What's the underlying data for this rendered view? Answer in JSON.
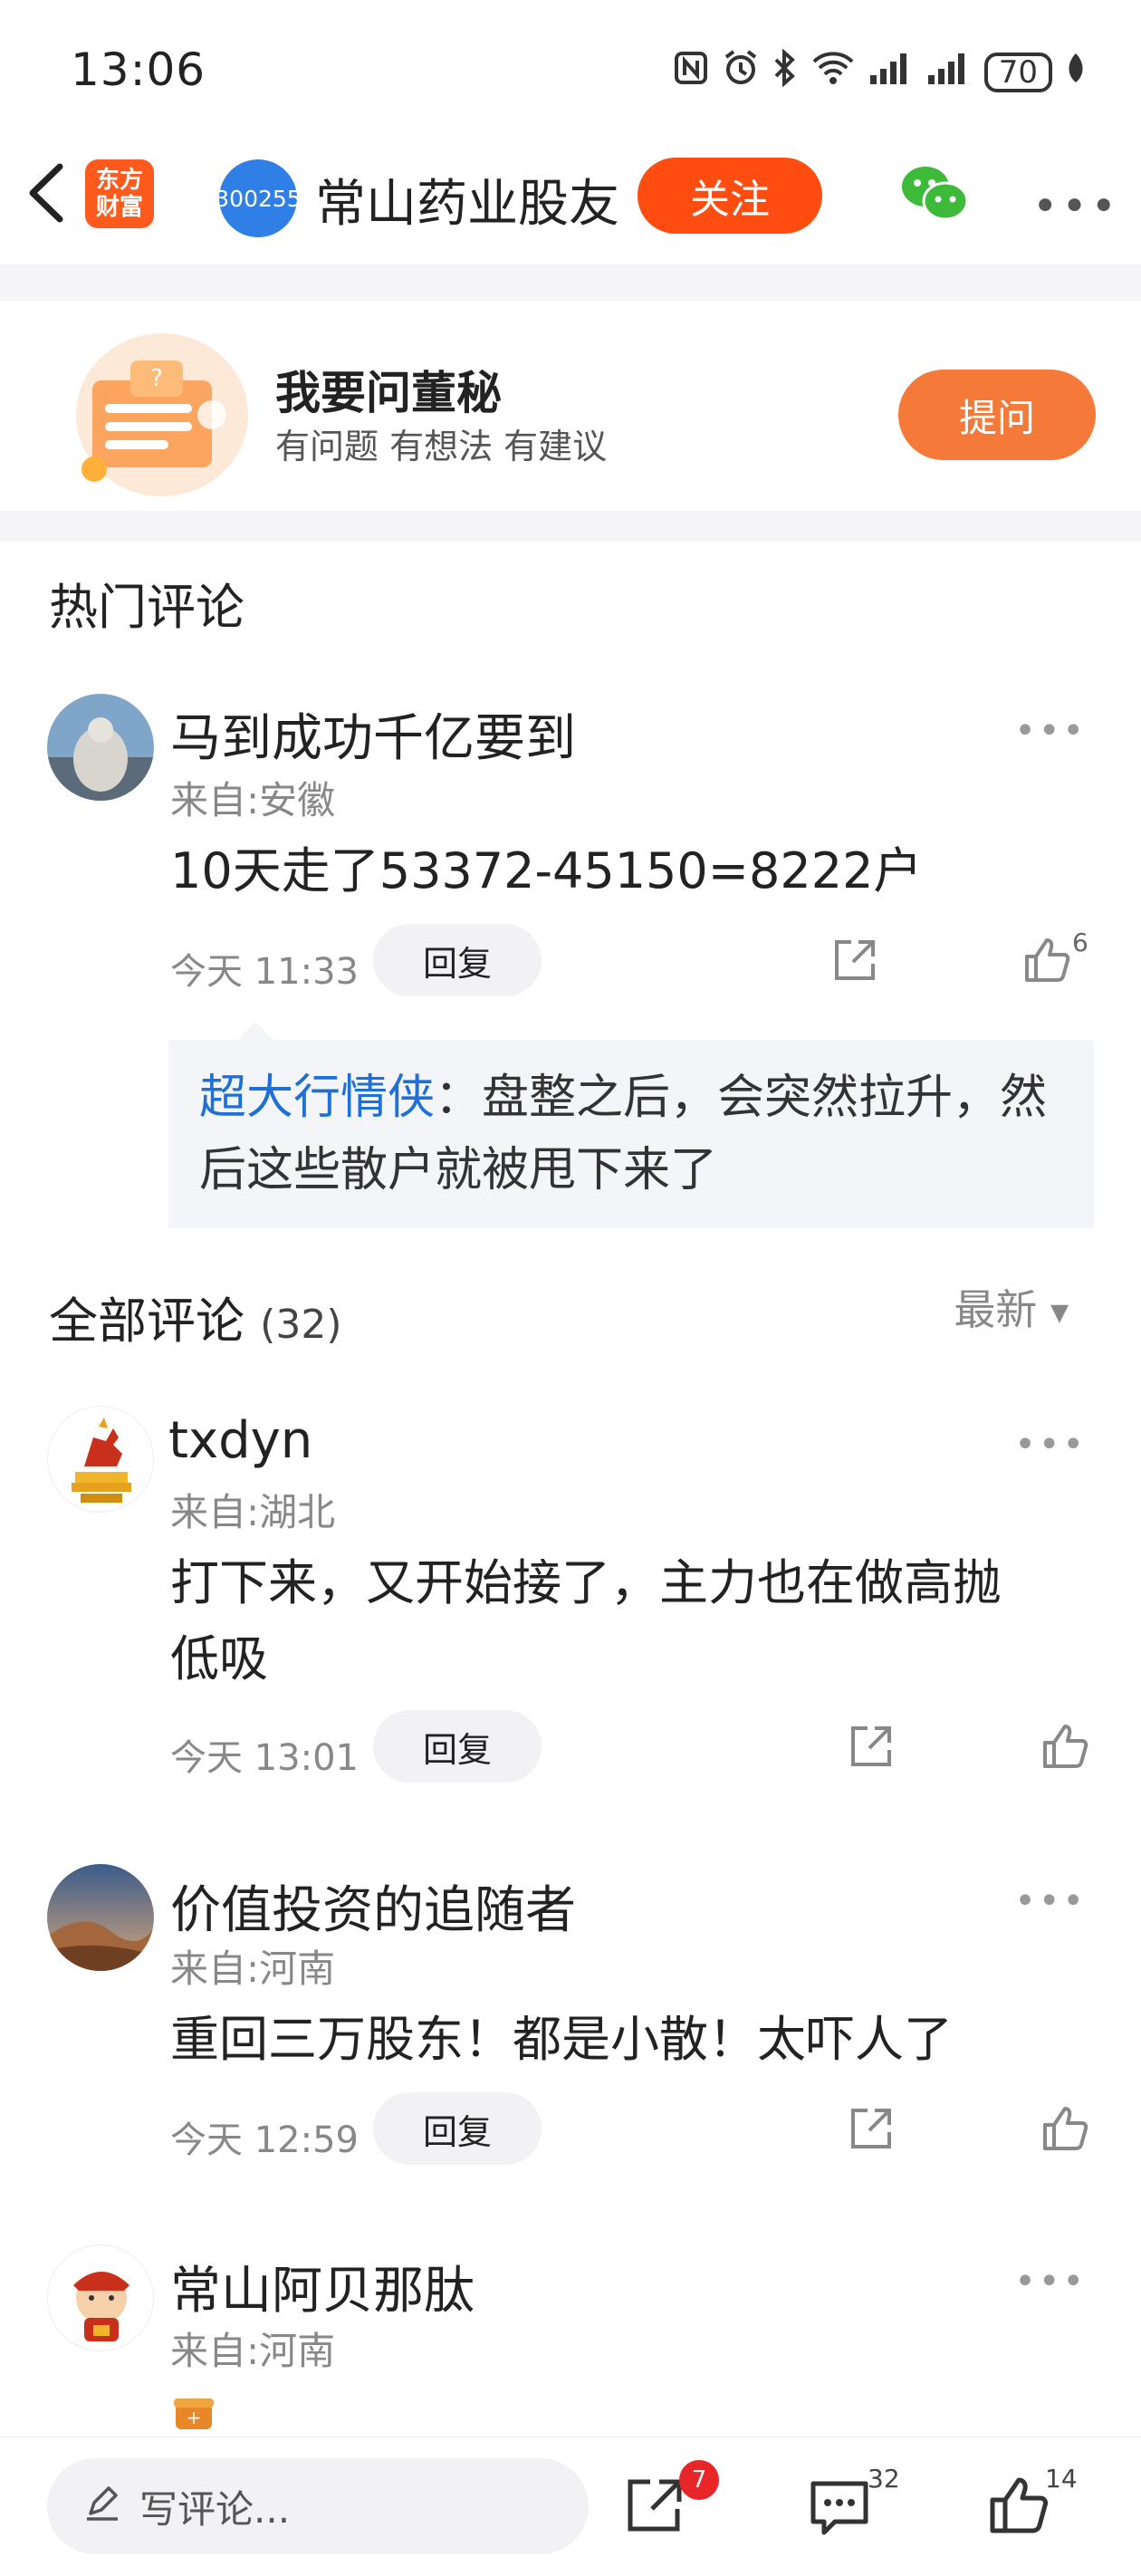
{
  "status_bar": {
    "time": "13:06",
    "battery": "70"
  },
  "nav": {
    "logo_line1": "东方",
    "logo_line2": "财富",
    "stock_code": "300255",
    "title": "常山药业股友",
    "follow_label": "关注"
  },
  "ask_card": {
    "title": "我要问董秘",
    "subtitle": "有问题 有想法 有建议",
    "button_label": "提问"
  },
  "hot_comments": {
    "title": "热门评论",
    "items": [
      {
        "user": "马到成功千亿要到",
        "location": "来自:安徽",
        "text": "10天走了53372-45150=8222户",
        "time": "今天 11:33",
        "reply_label": "回复",
        "likes": "6",
        "quote_user": "超大行情侠",
        "quote_text": "：盘整之后，会突然拉升，然后这些散户就被甩下来了"
      }
    ]
  },
  "all_comments": {
    "title": "全部评论",
    "count": "(32)",
    "sort_label": "最新",
    "items": [
      {
        "user": "txdyn",
        "location": "来自:湖北",
        "text_line1": "打下来，又开始接了，主力也在做高抛",
        "text_line2": "低吸",
        "time": "今天 13:01",
        "reply_label": "回复"
      },
      {
        "user": "价值投资的追随者",
        "location": "来自:河南",
        "text_line1": "重回三万股东！都是小散！太吓人了",
        "time": "今天 12:59",
        "reply_label": "回复"
      },
      {
        "user": "常山阿贝那肽",
        "location": "来自:河南"
      }
    ]
  },
  "bottom_bar": {
    "comment_placeholder": "写评论...",
    "share_badge": "7",
    "comment_count": "32",
    "like_count": "14"
  },
  "colors": {
    "accent": "#ff4d12",
    "link": "#1e6fd9",
    "stock_avatar": "#2f7fe6"
  }
}
